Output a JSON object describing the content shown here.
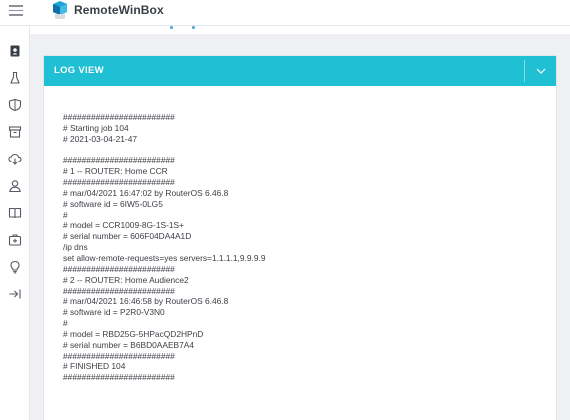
{
  "app": {
    "brand": "RemoteWinBox"
  },
  "sidebar": {
    "items": [
      {
        "icon": "contact-book-icon",
        "active": true
      },
      {
        "icon": "lab-flask-icon"
      },
      {
        "icon": "shield-icon"
      },
      {
        "icon": "archive-icon"
      },
      {
        "icon": "cloud-download-icon"
      },
      {
        "icon": "user-icon"
      },
      {
        "icon": "book-open-icon"
      },
      {
        "icon": "medkit-icon"
      },
      {
        "icon": "lightbulb-icon"
      },
      {
        "icon": "logout-arrow-icon"
      }
    ]
  },
  "panel": {
    "title": "LOG VIEW",
    "toggle_icon": "chevron-down-icon",
    "header_color": "#1fbfd4"
  },
  "log": {
    "lines": [
      "########################",
      "# Starting job 104",
      "# 2021-03-04-21-47",
      "",
      "########################",
      "# 1 -- ROUTER: Home CCR",
      "########################",
      "# mar/04/2021 16:47:02 by RouterOS 6.46.8",
      "# software id = 6IW5-0LG5",
      "#",
      "# model = CCR1009-8G-1S-1S+",
      "# serial number = 606F04DA4A1D",
      "/ip dns",
      "set allow-remote-requests=yes servers=1.1.1.1,9.9.9.9",
      "########################",
      "# 2 -- ROUTER: Home Audience2",
      "########################",
      "# mar/04/2021 16:46:58 by RouterOS 6.46.8",
      "# software id = P2R0-V3N0",
      "#",
      "# model = RBD25G-5HPacQD2HPnD",
      "# serial number = B6BD0AAEB7A4",
      "########################",
      "# FINISHED 104",
      "########################"
    ]
  }
}
